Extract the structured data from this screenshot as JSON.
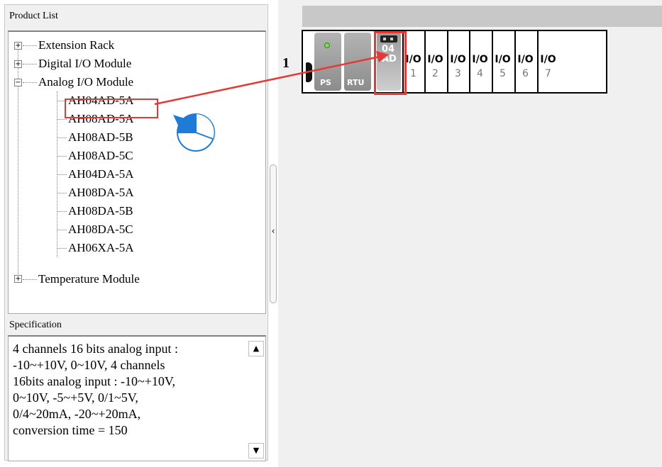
{
  "product_list": {
    "header": "Product List",
    "tree": [
      {
        "label": "Extension Rack",
        "expander": "+"
      },
      {
        "label": "Digital I/O Module",
        "expander": "+"
      },
      {
        "label": "Analog I/O Module",
        "expander": "−"
      },
      {
        "label": "AH04AD-5A"
      },
      {
        "label": "AH08AD-5A"
      },
      {
        "label": "AH08AD-5B"
      },
      {
        "label": "AH08AD-5C"
      },
      {
        "label": "AH04DA-5A"
      },
      {
        "label": "AH08DA-5A"
      },
      {
        "label": "AH08DA-5B"
      },
      {
        "label": "AH08DA-5C"
      },
      {
        "label": "AH06XA-5A"
      },
      {
        "label": "Temperature Module",
        "expander": "+"
      }
    ],
    "selected_item": "AH04AD-5A"
  },
  "specification": {
    "header": "Specification",
    "text": "4 channels 16 bits analog input :\n-10~+10V, 0~10V, 4 channels\n16bits analog input : -10~+10V,\n0~10V, -5~+5V, 0/1~5V,\n0/4~20mA, -20~+20mA,\nconversion time = 150",
    "scroll_up": "▲",
    "scroll_down": "▼"
  },
  "splitter": {
    "arrow": "‹"
  },
  "rack": {
    "step_label": "1",
    "ps_label": "PS",
    "rtu_label": "RTU",
    "ad_top": "04",
    "ad_bottom": "AD",
    "slots": [
      {
        "title": "I/O",
        "num": "1"
      },
      {
        "title": "I/O",
        "num": "2"
      },
      {
        "title": "I/O",
        "num": "3"
      },
      {
        "title": "I/O",
        "num": "4"
      },
      {
        "title": "I/O",
        "num": "5"
      },
      {
        "title": "I/O",
        "num": "6"
      },
      {
        "title": "I/O",
        "num": "7"
      }
    ]
  },
  "colors": {
    "highlight": "#e53935",
    "accent_blue": "#1e7bd6",
    "led_green": "#7ed957"
  },
  "icons": {
    "drag_arrow": "arrow-icon",
    "mouse_click": "left-click-icon"
  }
}
